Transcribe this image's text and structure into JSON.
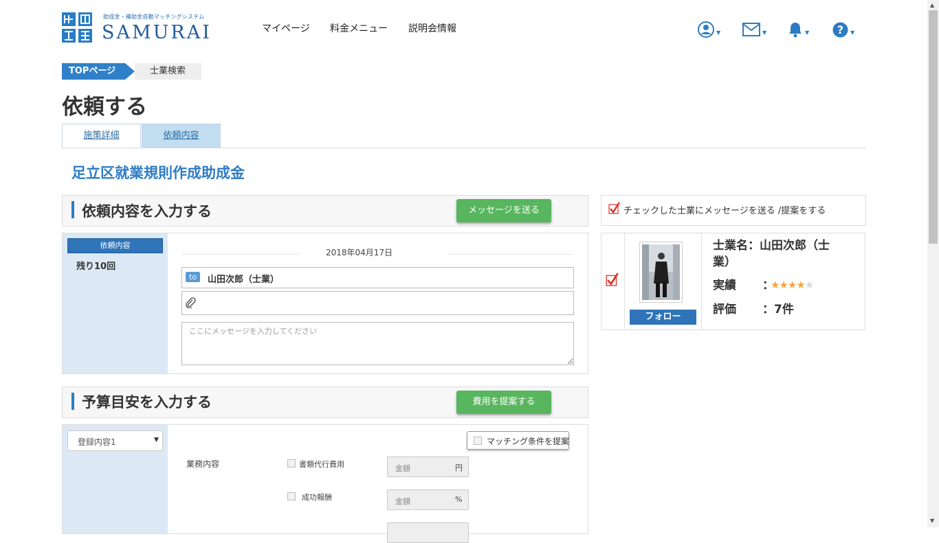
{
  "header": {
    "logo_tagline": "助成金・補助金自動マッチングシステム",
    "logo_text": "SAMURAI",
    "nav": [
      "マイページ",
      "料金メニュー",
      "説明会情報"
    ],
    "icons": [
      "user-icon",
      "mail-icon",
      "bell-icon",
      "help-icon"
    ]
  },
  "breadcrumb": {
    "home": "TOPページ",
    "current": "士業検索"
  },
  "page_title": "依頼する",
  "tabs": [
    "施策詳細",
    "依頼内容"
  ],
  "subsidy_title": "足立区就業規則作成助成金",
  "request_section": {
    "title": "依頼内容を入力する",
    "send_button": "メッセージを送る",
    "label": "依頼内容",
    "remaining": "残り10回",
    "date": "2018年04月17日",
    "to_badge": "to",
    "recipient": "山田次郎（士業）",
    "message_placeholder": "ここにメッセージを入力してください"
  },
  "budget_section": {
    "title": "予算目安を入力する",
    "propose_button": "費用を提案する",
    "select_value": "登録内容1",
    "matching_button": "マッチング条件を提案",
    "work_label": "業務内容",
    "items": [
      {
        "label": "書類代行費用",
        "placeholder": "金額",
        "unit": "円"
      },
      {
        "label": "成功報酬",
        "placeholder": "金額",
        "unit": "%"
      }
    ]
  },
  "right_panel": {
    "header": "チェックした士業にメッセージを送る /提案をする",
    "follow": "フォロー",
    "name_line1": "士業名：山田次郎（士",
    "name_line2": "業）",
    "achievement_label": "実績",
    "rating_label": "評価",
    "rating_value": "：7件",
    "colon": "："
  },
  "colors": {
    "accent_blue": "#2d7cc3",
    "tab_active": "#c2dcf0",
    "green_button": "#58b65e",
    "check_red": "#d9342b",
    "star": "#f3a43b"
  }
}
